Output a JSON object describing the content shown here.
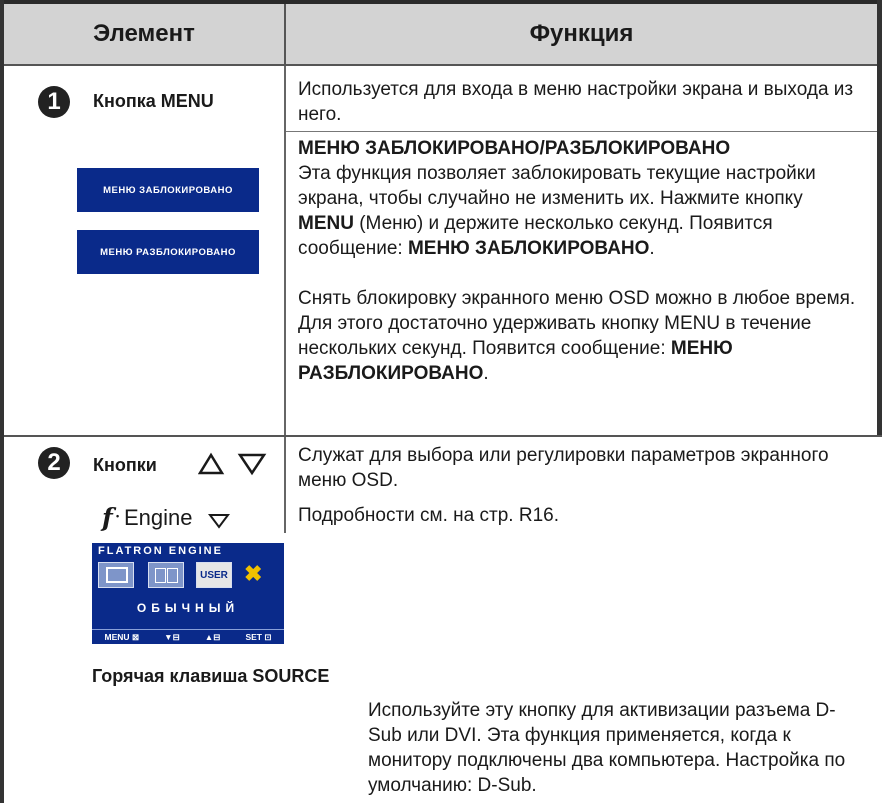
{
  "header": {
    "col_element": "Элемент",
    "col_function": "Функция"
  },
  "row1": {
    "number": "1",
    "label": "Кнопка MENU",
    "description": "Используется для входа в меню настройки экрана и выхода из него.",
    "lock_title": "МЕНЮ ЗАБЛОКИРОВАНО/РАЗБЛОКИРОВАНО",
    "lock_p1": "Эта функция позволяет заблокировать текущие настройки экрана, чтобы случайно не изменить их.",
    "lock_p2_pre": "Нажмите кнопку ",
    "lock_p2_menu": "MENU",
    "lock_p2_mid": " (Меню) и держите несколько секунд. Появится сообщение: ",
    "lock_p2_msg": "МЕНЮ ЗАБЛОКИРОВАНО",
    "lock_p2_end": ".",
    "unlock_p": "Снять блокировку экранного меню OSD можно в любое время. Для этого достаточно удерживать кнопку MENU в течение нескольких секунд. Появится сообщение: ",
    "unlock_msg": "МЕНЮ РАЗБЛОКИРОВАНО",
    "unlock_end": ".",
    "osd_locked": "МЕНЮ ЗАБЛОКИРОВАНО",
    "osd_unlocked": "МЕНЮ РАЗБЛОКИРОВАНО"
  },
  "row2": {
    "number": "2",
    "label": "Кнопки",
    "description": "Служат для выбора или регулировки параметров экранного меню OSD.",
    "fengine_label": "Engine",
    "fengine_desc": "Подробности см. на стр. R16.",
    "screen_title": "FLATRON  ENGINE",
    "screen_user": "USER",
    "screen_mode": "ОБЫЧНЫЙ",
    "screen_menu": "MENU",
    "screen_set": "SET"
  },
  "source": {
    "title": "Горячая клавиша SOURCE",
    "description": "Используйте эту кнопку для активизации разъема D-Sub или DVI. Эта функция применяется, когда к монитору подключены два компьютера. Настройка по умолчанию: D-Sub."
  },
  "colors": {
    "osd_blue": "#0a2a8a",
    "header_gray": "#d3d3d3"
  }
}
